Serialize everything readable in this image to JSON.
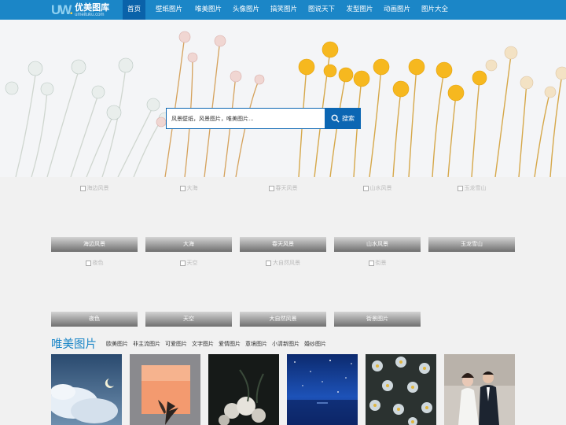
{
  "brand": {
    "logo_mark": "UW",
    "name": "优美图库",
    "domain": "umeituku.com"
  },
  "nav": {
    "items": [
      {
        "label": "首页",
        "active": true
      },
      {
        "label": "壁纸图片"
      },
      {
        "label": "唯美图片"
      },
      {
        "label": "头像图片"
      },
      {
        "label": "搞笑图片"
      },
      {
        "label": "图说天下"
      },
      {
        "label": "发型图片"
      },
      {
        "label": "动画图片"
      },
      {
        "label": "图片大全"
      }
    ]
  },
  "search": {
    "value": "风景壁纸，风景图片，唯美图片...",
    "button_label": "搜索"
  },
  "categories": [
    {
      "alt": "海边风景",
      "label": "海边风景"
    },
    {
      "alt": "大海",
      "label": "大海"
    },
    {
      "alt": "春天风景",
      "label": "春天风景"
    },
    {
      "alt": "山水风景",
      "label": "山水风景"
    },
    {
      "alt": "玉龙雪山",
      "label": "玉龙雪山"
    },
    {
      "alt": "夜色",
      "label": "夜色"
    },
    {
      "alt": "天空",
      "label": "天空"
    },
    {
      "alt": "大自然风景",
      "label": "大自然风景"
    },
    {
      "alt": "街景",
      "label": "街景图片"
    }
  ],
  "section": {
    "title": "唯美图片",
    "tags": [
      "欧美图片",
      "非主流图片",
      "可爱图片",
      "文字图片",
      "爱情图片",
      "意境图片",
      "小清新图片",
      "婚纱图片"
    ]
  },
  "thumbnails": [
    {
      "subject": "clouds-moon"
    },
    {
      "subject": "sunset-window-plant"
    },
    {
      "subject": "white-roses-dark"
    },
    {
      "subject": "starry-night-sea"
    },
    {
      "subject": "daisies-dark"
    },
    {
      "subject": "wedding-couple"
    }
  ]
}
